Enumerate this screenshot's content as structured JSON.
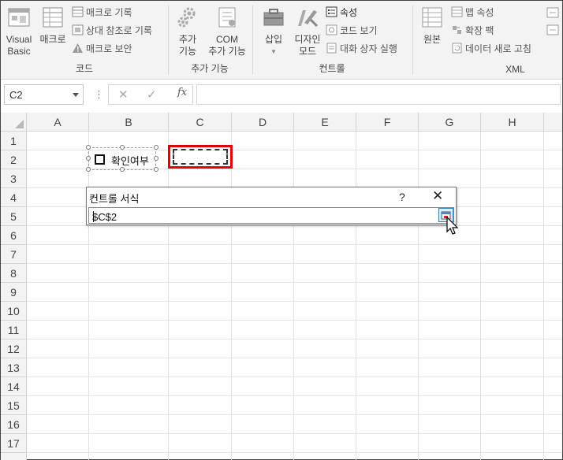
{
  "ribbon": {
    "code_group": {
      "label": "코드",
      "visual_basic": [
        "Visual",
        "Basic"
      ],
      "macros": "매크로",
      "record_macro": "매크로 기록",
      "relative_ref": "상대 참조로 기록",
      "macro_security": "매크로 보안"
    },
    "addins_group": {
      "label": "추가 기능",
      "addins": [
        "추가",
        "기능"
      ],
      "com_addins": [
        "COM",
        "추가 기능"
      ]
    },
    "controls_group": {
      "label": "컨트롤",
      "insert": "삽입",
      "design_mode": [
        "디자인",
        "모드"
      ],
      "properties": "속성",
      "view_code": "코드 보기",
      "run_dialog": "대화 상자 실행"
    },
    "xml_group": {
      "label": "XML",
      "source": "원본",
      "map_properties": "맵 속성",
      "expansion_packs": "확장 팩",
      "refresh_data": "데이터 새로 고침"
    }
  },
  "formula_bar": {
    "name_box": "C2",
    "dots": "⋮",
    "cancel": "✕",
    "enter": "✓",
    "fx": "fx",
    "formula": ""
  },
  "grid": {
    "columns": [
      "A",
      "B",
      "C",
      "D",
      "E",
      "F",
      "G",
      "H"
    ],
    "rows": [
      "1",
      "2",
      "3",
      "4",
      "5",
      "6",
      "7",
      "8",
      "9",
      "10",
      "11",
      "12",
      "13",
      "14",
      "15",
      "16",
      "17"
    ]
  },
  "checkbox_control": {
    "label": "확인여부"
  },
  "dialog": {
    "title": "컨트롤 서식",
    "help": "?",
    "close": "✕",
    "value": "$C$2"
  }
}
